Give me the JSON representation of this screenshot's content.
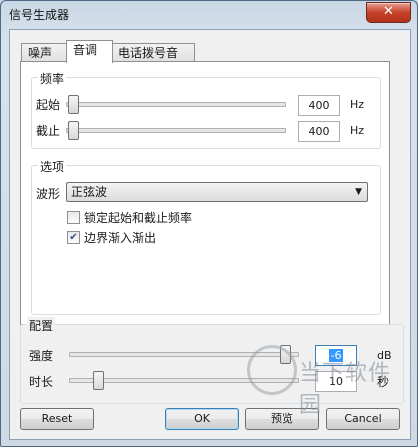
{
  "window": {
    "title": "信号生成器",
    "close_glyph": "✕"
  },
  "tabs": [
    {
      "label": "噪声"
    },
    {
      "label": "音调"
    },
    {
      "label": "电话拨号音"
    }
  ],
  "frequency": {
    "group_label": "频率",
    "start": {
      "label": "起始",
      "value": "400",
      "unit": "Hz",
      "slider_fraction": 0.0
    },
    "cutoff": {
      "label": "截止",
      "value": "400",
      "unit": "Hz",
      "slider_fraction": 0.0
    }
  },
  "options": {
    "group_label": "选项",
    "waveform_label": "波形",
    "waveform_value": "正弦波",
    "lock_label": "锁定起始和截止频率",
    "lock_checked": false,
    "fade_label": "边界渐入渐出",
    "fade_checked": true
  },
  "config": {
    "group_label": "配置",
    "strength": {
      "label": "强度",
      "value": "-6",
      "unit": "dB",
      "slider_fraction": 0.96
    },
    "duration": {
      "label": "时长",
      "value": "10",
      "unit": "秒",
      "slider_fraction": 0.1
    }
  },
  "buttons": {
    "reset": "Reset",
    "ok": "OK",
    "preview": "预览",
    "cancel": "Cancel"
  },
  "watermark": {
    "text": "当下软件园"
  }
}
